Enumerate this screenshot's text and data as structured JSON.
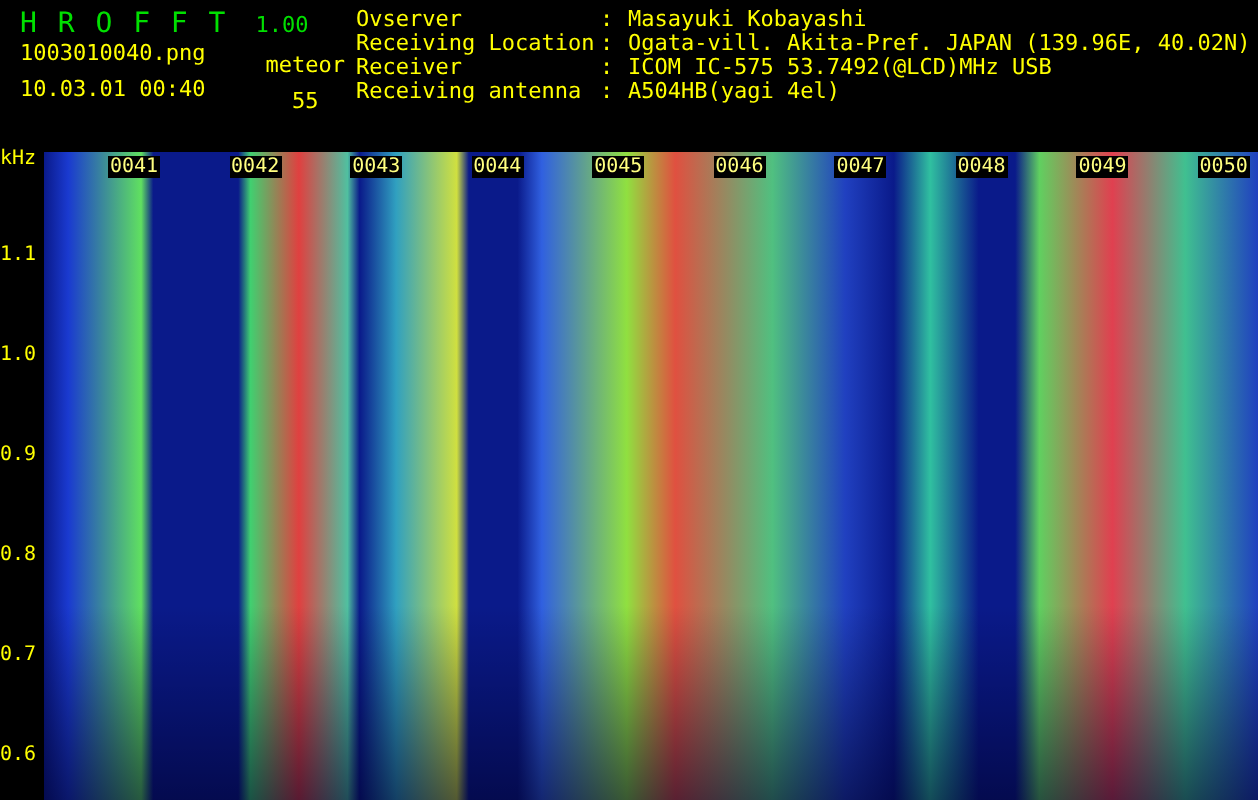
{
  "app": {
    "title": "H R O F F T",
    "version": "1.00",
    "file": "1003010040.png",
    "timestamp": "10.03.01 00:40",
    "count_label": "meteor",
    "count": "55"
  },
  "info": [
    {
      "label": "Ovserver",
      "value": "Masayuki Kobayashi"
    },
    {
      "label": "Receiving Location",
      "value": "Ogata-vill. Akita-Pref. JAPAN (139.96E, 40.02N)"
    },
    {
      "label": "Receiver",
      "value": "ICOM IC-575 53.7492(@LCD)MHz USB"
    },
    {
      "label": "Receiving antenna",
      "value": "A504HB(yagi 4el)"
    }
  ],
  "separator": ":",
  "axis_unit": "kHz",
  "y_ticks": [
    "1.1",
    "1.0",
    "0.9",
    "0.8",
    "0.7",
    "0.6"
  ],
  "time_labels": [
    "0041",
    "0042",
    "0043",
    "0044",
    "0045",
    "0046",
    "0047",
    "0048",
    "0049",
    "0050"
  ]
}
